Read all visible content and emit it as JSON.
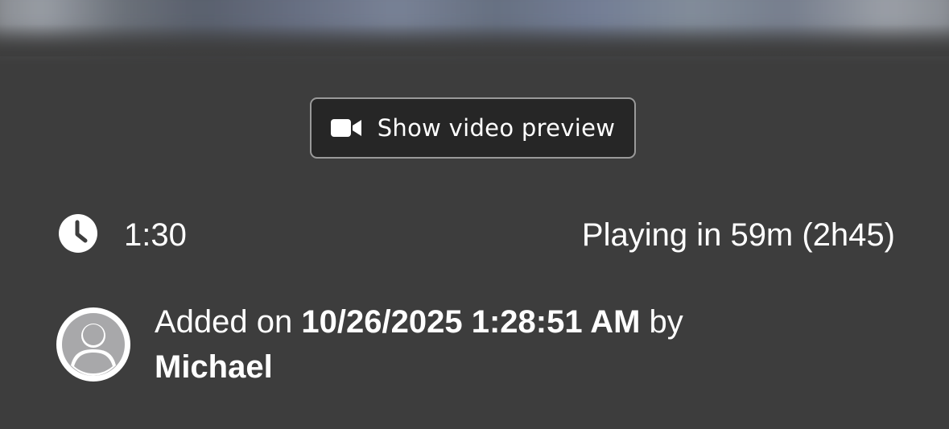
{
  "preview_button": {
    "label": "Show video preview",
    "icon": "video-camera-icon"
  },
  "duration": {
    "icon": "clock-icon",
    "value": "1:30"
  },
  "showtime": {
    "text": "Playing in 59m (2h45)"
  },
  "added": {
    "prefix": "Added on",
    "datetime": "10/26/2025 1:28:51 AM",
    "by": "by",
    "user": "Michael",
    "avatar_icon": "default-avatar-icon"
  },
  "colors": {
    "background": "#3d3d3d",
    "button_background": "#262626",
    "button_border": "#9a9a9a",
    "text": "#ffffff",
    "avatar_fill": "#a8a8aa"
  }
}
